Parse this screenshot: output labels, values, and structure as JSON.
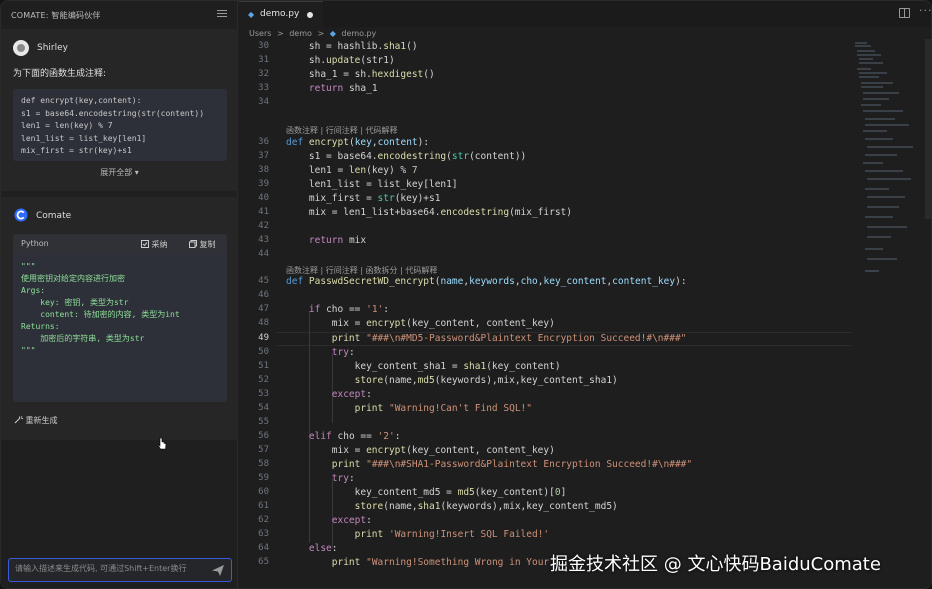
{
  "left_panel": {
    "title": "COMATE: 智能编码伙伴",
    "user": {
      "name": "Shirley",
      "prompt": "为下面的函数生成注释:"
    },
    "user_code": [
      "def encrypt(key,content):",
      "s1 = base64.encodestring(str(content))",
      "len1 = len(key) % 7",
      "len1_list = list_key[len1]",
      "mix_first = str(key)+s1"
    ],
    "expand_label": "展开全部 ▾",
    "bot": {
      "name": "Comate"
    },
    "code_block": {
      "lang": "Python",
      "adopt_label": "采纳",
      "copy_label": "复制",
      "lines": [
        "\"\"\"",
        "使用密钥对给定内容进行加密",
        "",
        "Args:",
        "    key: 密钥, 类型为str",
        "    content: 待加密的内容, 类型为int",
        "",
        "Returns:",
        "    加密后的字符串, 类型为str",
        "",
        "\"\"\""
      ]
    },
    "regen_label": "重新生成",
    "input_placeholder": "请输入描述来生成代码, 可通过Shift+Enter换行"
  },
  "editor": {
    "tab_name": "demo.py",
    "breadcrumb": [
      "Users",
      ">",
      "demo",
      ">",
      "demo.py"
    ],
    "code_hint_1": "函数注释 | 行间注释 | 代码解释",
    "code_hint_2": "函数注释 | 行间注释 | 函数拆分 | 代码解释",
    "line_numbers": [
      "30",
      "31",
      "32",
      "33",
      "34",
      "35",
      "36",
      "37",
      "38",
      "39",
      "40",
      "41",
      "42",
      "43",
      "44",
      "45",
      "46",
      "47",
      "48",
      "49",
      "50",
      "51",
      "52",
      "53",
      "54",
      "55",
      "56",
      "57",
      "58",
      "59",
      "60",
      "61",
      "62",
      "63",
      "64",
      "65"
    ],
    "current_line": "49"
  },
  "watermark": "掘金技术社区 @ 文心快码BaiduComate",
  "colors": {
    "accent": "#3b5bdb",
    "keyword": "#569cd6",
    "string": "#ce9178",
    "function": "#dcdcaa"
  }
}
